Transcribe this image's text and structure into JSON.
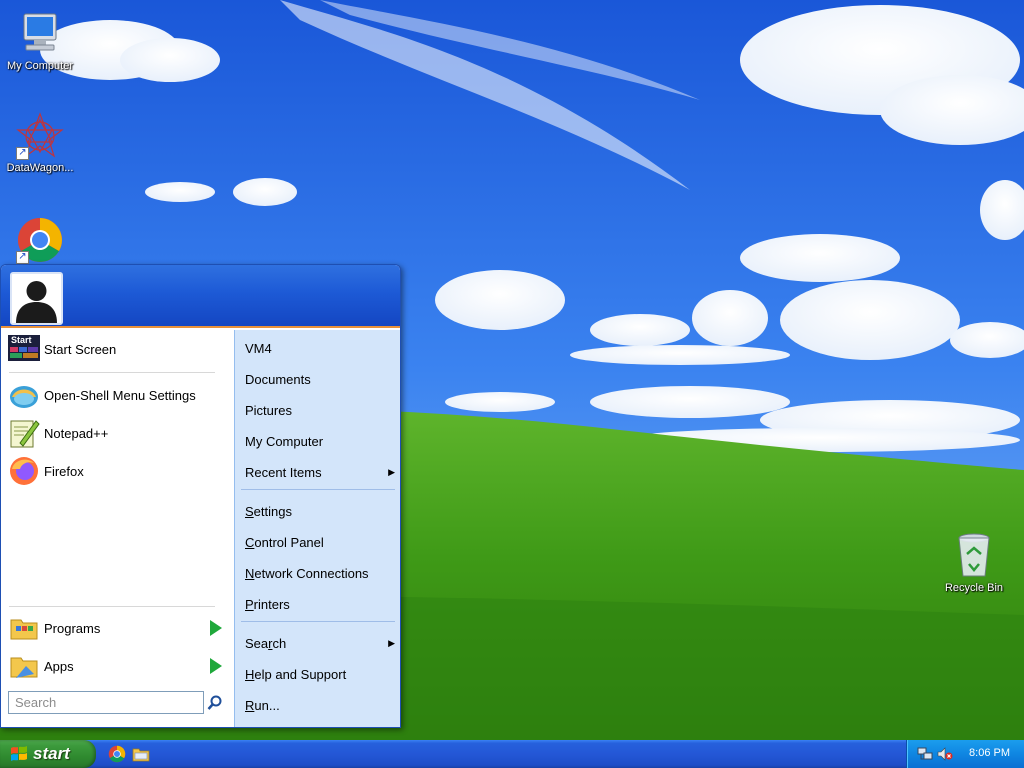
{
  "desktop": {
    "icons": [
      {
        "label": "My Computer",
        "icon": "computer-icon"
      },
      {
        "label": "DataWagon...",
        "icon": "datawagon-icon"
      },
      {
        "label": "",
        "icon": "chrome-icon"
      },
      {
        "label": "Recycle Bin",
        "icon": "recycle-bin-icon"
      }
    ]
  },
  "start_menu": {
    "user_avatar": "user-avatar-icon",
    "left_top_items": [
      {
        "label": "Start Screen",
        "icon": "start-screen-icon",
        "badge": "Start"
      },
      {
        "label": "Open-Shell Menu Settings",
        "icon": "open-shell-icon"
      },
      {
        "label": "Notepad++",
        "icon": "notepad-plus-plus-icon"
      },
      {
        "label": "Firefox",
        "icon": "firefox-icon"
      }
    ],
    "left_bottom_items": [
      {
        "label": "Programs",
        "icon": "programs-folder-icon"
      },
      {
        "label": "Apps",
        "icon": "apps-folder-icon"
      }
    ],
    "search": {
      "placeholder": "Search"
    },
    "right_items": [
      {
        "label": "VM4"
      },
      {
        "label": "Documents"
      },
      {
        "label": "Pictures"
      },
      {
        "label": "My Computer"
      },
      {
        "label": "Recent Items",
        "submenu": true
      },
      {
        "label_pre": "",
        "label_key": "S",
        "label_post": "ettings"
      },
      {
        "label_pre": "",
        "label_key": "C",
        "label_post": "ontrol Panel"
      },
      {
        "label_pre": "",
        "label_key": "N",
        "label_post": "etwork Connections"
      },
      {
        "label_pre": "",
        "label_key": "P",
        "label_post": "rinters"
      },
      {
        "label_pre": "Sea",
        "label_key": "r",
        "label_post": "ch",
        "submenu": true
      },
      {
        "label_pre": "",
        "label_key": "H",
        "label_post": "elp and Support"
      },
      {
        "label_pre": "",
        "label_key": "R",
        "label_post": "un..."
      }
    ]
  },
  "taskbar": {
    "start_label": "start",
    "quick_launch": [
      "chrome-icon",
      "file-explorer-icon"
    ],
    "tray_icons": [
      "network-icon",
      "volume-muted-icon"
    ],
    "clock": "8:06 PM"
  },
  "colors": {
    "taskbar_blue": "#2457d6",
    "start_green": "#2f8a2f",
    "menu_header_blue": "#1d5ad6",
    "menu_right_pane": "#d3e5fa",
    "menu_separator_orange": "#e8913a"
  }
}
